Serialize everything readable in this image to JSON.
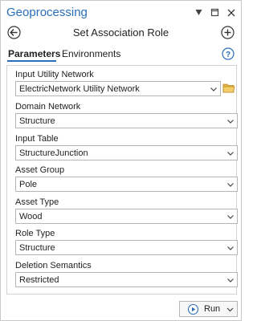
{
  "pane": {
    "title": "Geoprocessing",
    "accent_color": "#2a6ebb",
    "controls": [
      "pin-icon",
      "menu-icon",
      "close-icon"
    ]
  },
  "tool": {
    "title": "Set Association Role",
    "back_icon": "back-arrow-icon",
    "add_icon": "plus-icon"
  },
  "tabs": [
    {
      "label": "Parameters",
      "active": true
    },
    {
      "label": "Environments",
      "active": false
    }
  ],
  "help_icon": "help-icon",
  "fields": [
    {
      "label": "Input Utility Network",
      "value": "ElectricNetwork Utility Network",
      "has_browse": true
    },
    {
      "label": "Domain Network",
      "value": "Structure"
    },
    {
      "label": "Input Table",
      "value": "StructureJunction"
    },
    {
      "label": "Asset Group",
      "value": "Pole"
    },
    {
      "label": "Asset Type",
      "value": "Wood"
    },
    {
      "label": "Role Type",
      "value": "Structure"
    },
    {
      "label": "Deletion Semantics",
      "value": "Restricted"
    }
  ],
  "run_button": {
    "label": "Run"
  }
}
